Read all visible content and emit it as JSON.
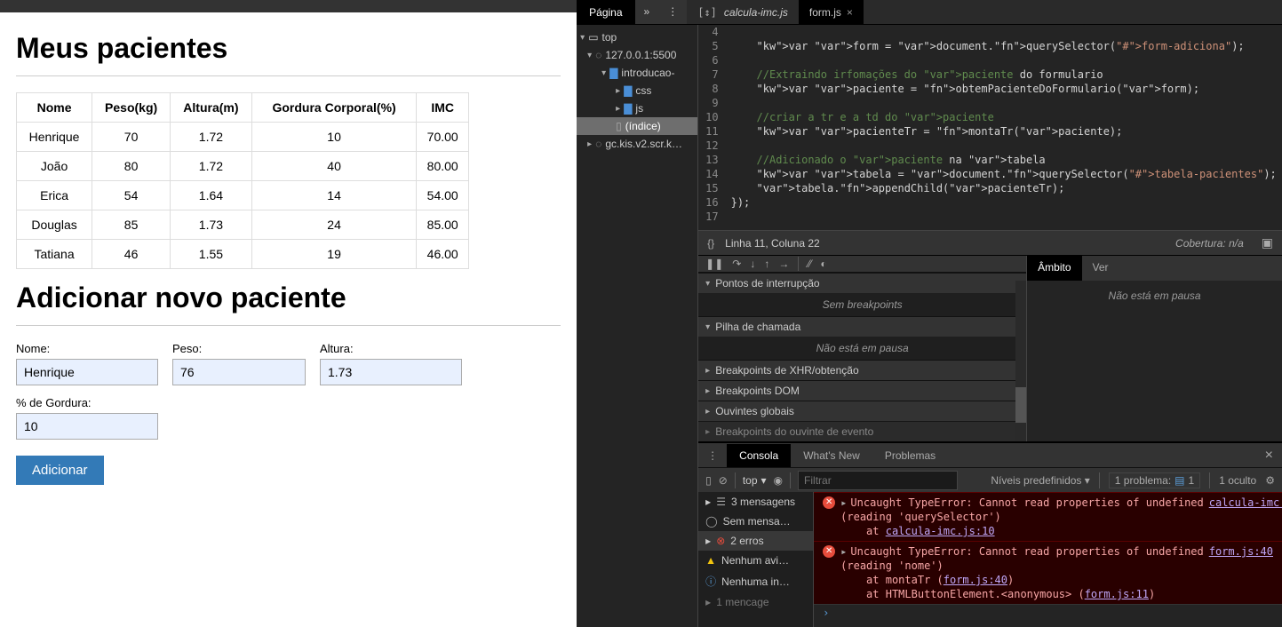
{
  "page": {
    "h1a": "Meus pacientes",
    "h1b": "Adicionar novo paciente",
    "table": {
      "headers": [
        "Nome",
        "Peso(kg)",
        "Altura(m)",
        "Gordura Corporal(%)",
        "IMC"
      ],
      "rows": [
        [
          "Henrique",
          "70",
          "1.72",
          "10",
          "70.00"
        ],
        [
          "João",
          "80",
          "1.72",
          "40",
          "80.00"
        ],
        [
          "Erica",
          "54",
          "1.64",
          "14",
          "54.00"
        ],
        [
          "Douglas",
          "85",
          "1.73",
          "24",
          "85.00"
        ],
        [
          "Tatiana",
          "46",
          "1.55",
          "19",
          "46.00"
        ]
      ]
    },
    "form": {
      "nome_label": "Nome:",
      "nome_value": "Henrique",
      "peso_label": "Peso:",
      "peso_value": "76",
      "altura_label": "Altura:",
      "altura_value": "1.73",
      "gordura_label": "% de Gordura:",
      "gordura_value": "10",
      "submit": "Adicionar"
    }
  },
  "devtools": {
    "top_tab": "Página",
    "file_tabs": {
      "a": "calcula-imc.js",
      "b": "form.js"
    },
    "tree": {
      "top": "top",
      "host": "127.0.0.1:5500",
      "folder_root": "introducao-",
      "folder_css": "css",
      "folder_js": "js",
      "indice": "(índice)",
      "gc": "gc.kis.v2.scr.k…"
    },
    "code": {
      "first_line": 4,
      "lines": [
        "",
        "    var form = document.querySelector(\"#form-adiciona\");",
        "",
        "    //Extraindo irfomações do paciente do formulario",
        "    var paciente = obtemPacienteDoFormulario(form);",
        "",
        "    //criar a tr e a td do paciente",
        "    var pacienteTr = montaTr(paciente);",
        "",
        "    //Adicionado o paciente na tabela",
        "    var tabela = document.querySelector(\"#tabela-pacientes\");",
        "    tabela.appendChild(pacienteTr);",
        "});",
        ""
      ]
    },
    "status": {
      "pos": "Linha 11, Coluna 22",
      "cov": "Cobertura: n/a"
    },
    "debug": {
      "bp_header": "Pontos de interrupção",
      "bp_empty": "Sem breakpoints",
      "call_header": "Pilha de chamada",
      "call_empty": "Não está em pausa",
      "xhr": "Breakpoints de XHR/obtenção",
      "dom": "Breakpoints DOM",
      "globals": "Ouvintes globais",
      "evt": "Breakpoints do ouvinte de evento"
    },
    "scope": {
      "tab_a": "Âmbito",
      "tab_b": "Ver",
      "body": "Não está em pausa"
    },
    "console_tabs": {
      "a": "Consola",
      "b": "What's New",
      "c": "Problemas"
    },
    "console_toolbar": {
      "ctx": "top",
      "filter_ph": "Filtrar",
      "levels": "Níveis predefinidos",
      "problem_label": "1 problema:",
      "problem_count": "1",
      "hidden": "1 oculto"
    },
    "console_left": {
      "msgs": "3 mensagens",
      "user": "Sem mensa…",
      "errs": "2 erros",
      "warn": "Nenhum avi…",
      "info": "Nenhuma in…",
      "one": "1 mencage"
    },
    "errors": {
      "e1_head": "Uncaught TypeError: Cannot read properties of undefined",
      "e1_sub": "(reading 'querySelector')",
      "e1_at": "    at ",
      "e1_link1": "calcula-imc.js:10",
      "e1_src": "calcula-imc.js:10",
      "e2_head": "Uncaught TypeError: Cannot read properties of undefined",
      "e2_sub": "(reading 'nome')",
      "e2_at1a": "    at montaTr (",
      "e2_at1b": "form.js:40",
      "e2_at2a": "    at HTMLButtonElement.<anonymous> (",
      "e2_at2b": "form.js:11",
      "e2_src": "form.js:40"
    }
  }
}
